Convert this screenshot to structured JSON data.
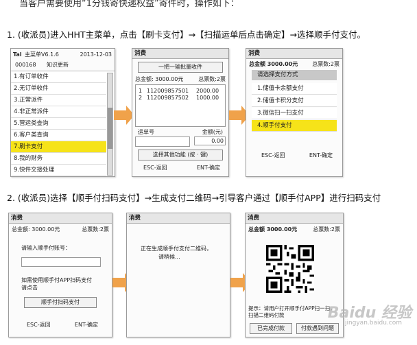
{
  "intro": "当客户需要使用“1分钱寄快递权益”寄件时，操作如下：",
  "step1": "1. (收派员)进入HHT主菜单，点击【刷卡支付】→【扫描运单后点击确定】→选择顺手付支付。",
  "step2": "2. (收派员)选择【顺手付扫码支付】→生成支付二维码→引导客户通过【顺手付APP】进行扫码支付",
  "screen1": {
    "title": "主菜单V6.1.6",
    "logo": "Tal",
    "date": "2013-12-03",
    "code": "000168",
    "update": "知识更新",
    "items": [
      "1.有订单收件",
      "2.无订单收件",
      "3.正常派件",
      "4.非正常派件",
      "5.营运类查询",
      "6.客户类查询",
      "7.刷卡支付",
      "8.我的财务",
      "9.快件交接处理"
    ]
  },
  "screen2": {
    "title": "消费",
    "collect_btn": "一把一输批量收件",
    "total_amount": "总金额: 3000.00元",
    "total_count": "总票数:2票",
    "rows": [
      {
        "no": "1",
        "waybill": "112009857501",
        "amount": "2000.00"
      },
      {
        "no": "2",
        "waybill": "112009857502",
        "amount": "1000.00"
      }
    ],
    "waybill_label": "运单号",
    "amount_label": "金额(元)",
    "amount_value": "0.00",
    "func_btn": "选择其他功能 (按 · 键)",
    "esc": "ESC-返回",
    "ent": "ENT-确定"
  },
  "screen3": {
    "title": "消费",
    "total_amount": "总金额 3000.00元",
    "total_count": "总票数:2票",
    "header": "请选择支付方式",
    "options": [
      "1.储值卡余额支付",
      "2.储值卡积分支付",
      "3.微信扫一扫支付",
      "4.顺手付支付"
    ],
    "esc": "ESC-返回",
    "ent": "ENT-确定"
  },
  "screen4": {
    "title": "消费",
    "total_amount": "总金额: 3000.00元",
    "total_count": "总票数:2票",
    "input_label": "请输入顺手付账号：",
    "hint": "如需使用顺手付APP扫码支付请点击",
    "btn": "顺手付扫码支付",
    "esc": "ESC-返回",
    "ent": "ENT-确定"
  },
  "screen5": {
    "title": "消费",
    "line1": "正在生成顺手付支付二维码，",
    "line2": "请稍候..."
  },
  "screen6": {
    "title": "消费",
    "total_amount": "总金额 3000.00元",
    "total_count": "总票数:2票",
    "tip": "提示：请用户打开顺手付APP扫一扫，扫描二维码付款",
    "btn1": "已完成付款",
    "btn2": "付款遇到问题"
  },
  "watermark": "Baidu 经验",
  "watermark_sub": "jingyan.baidu.com",
  "colors": {
    "highlight": "#f6e319",
    "arrow": "#f0a24a"
  }
}
